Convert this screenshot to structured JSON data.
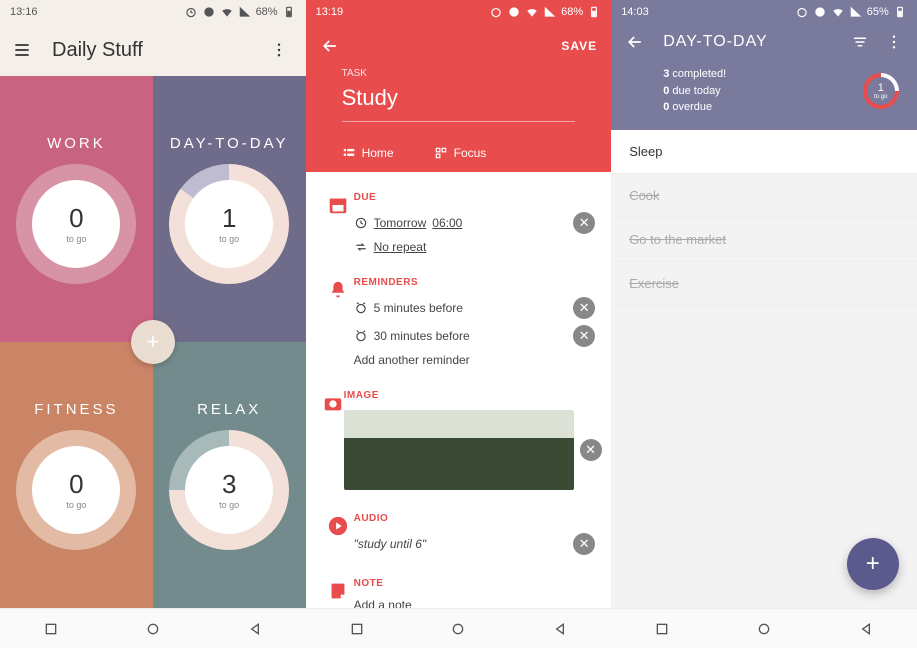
{
  "screen1": {
    "status": {
      "time": "13:16",
      "battery": "68%"
    },
    "appbar": {
      "title": "Daily Stuff"
    },
    "tiles": [
      {
        "title": "WORK",
        "count": "0",
        "label": "to go"
      },
      {
        "title": "DAY-TO-DAY",
        "count": "1",
        "label": "to go"
      },
      {
        "title": "FITNESS",
        "count": "0",
        "label": "to go"
      },
      {
        "title": "RELAX",
        "count": "3",
        "label": "to go"
      }
    ]
  },
  "screen2": {
    "status": {
      "time": "13:19",
      "battery": "68%"
    },
    "save": "SAVE",
    "task_label": "TASK",
    "task_name": "Study",
    "tabs": {
      "home": "Home",
      "focus": "Focus"
    },
    "due": {
      "title": "DUE",
      "when_prefix": "Tomorrow",
      "when_time": "06:00",
      "repeat": "No repeat"
    },
    "reminders": {
      "title": "REMINDERS",
      "r1": "5 minutes before",
      "r2": "30 minutes before",
      "add": "Add another reminder"
    },
    "image": {
      "title": "IMAGE"
    },
    "audio": {
      "title": "AUDIO",
      "text": "\"study until 6\""
    },
    "note": {
      "title": "NOTE",
      "text": "Add a note"
    }
  },
  "screen3": {
    "status": {
      "time": "14:03",
      "battery": "65%"
    },
    "title": "DAY-TO-DAY",
    "stats": {
      "completed_n": "3",
      "completed_t": " completed!",
      "due_n": "0",
      "due_t": " due today",
      "overdue_n": "0",
      "overdue_t": " overdue",
      "ring_count": "1",
      "ring_label": "to go"
    },
    "items": [
      {
        "text": "Sleep",
        "done": false
      },
      {
        "text": "Cook",
        "done": true
      },
      {
        "text": "Go to the market",
        "done": true
      },
      {
        "text": "Exercise",
        "done": true
      }
    ]
  }
}
